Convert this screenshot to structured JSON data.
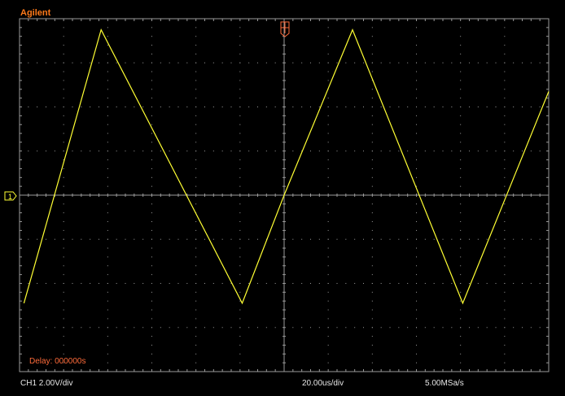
{
  "scope": {
    "brand": "Agilent",
    "delay_label": "Delay: 000000s",
    "channel_scale": "CH1 2.00V/div",
    "time_scale": "20.00us/div",
    "sample_rate": "5.00MSa/s",
    "channel_marker": "1",
    "colors": {
      "trace": "#ffff33",
      "brand": "#ff7a1a",
      "grid": "#9a9a9a",
      "marker": "#ffff33",
      "trigger": "#ff6b3a"
    }
  },
  "chart_data": {
    "type": "line",
    "title": "",
    "xlabel": "",
    "ylabel": "",
    "x_unit": "us",
    "y_unit": "V",
    "xlim": [
      -120,
      120
    ],
    "ylim": [
      -8,
      8
    ],
    "grid": true,
    "series": [
      {
        "values_xy": [
          [
            -118,
            -4.9
          ],
          [
            -83,
            7.5
          ],
          [
            -19,
            -4.9
          ],
          [
            0,
            0
          ],
          [
            31,
            7.5
          ],
          [
            81,
            -4.9
          ],
          [
            120,
            4.7
          ]
        ]
      }
    ]
  }
}
